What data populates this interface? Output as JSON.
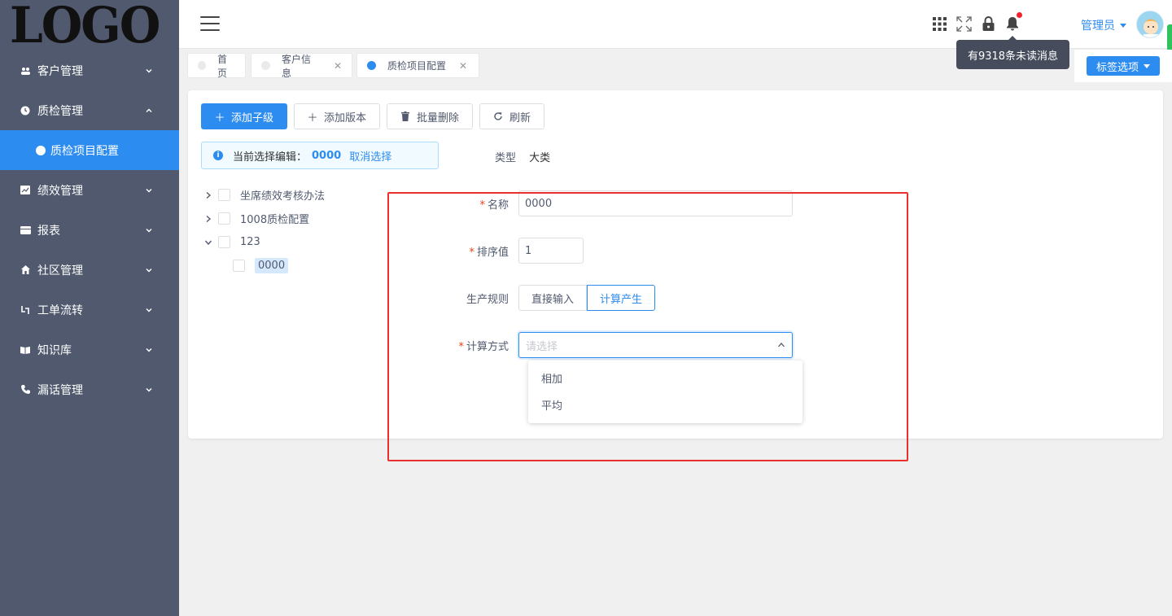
{
  "logo": "LOGO",
  "sidebar": {
    "items": [
      {
        "label": "客户管理",
        "icon": "users-icon",
        "expanded": false
      },
      {
        "label": "质检管理",
        "icon": "clock-icon",
        "expanded": true,
        "children": [
          {
            "label": "质检项目配置",
            "icon": "dot-icon"
          }
        ]
      },
      {
        "label": "绩效管理",
        "icon": "chart-icon",
        "expanded": false
      },
      {
        "label": "报表",
        "icon": "table-icon",
        "expanded": false
      },
      {
        "label": "社区管理",
        "icon": "home-icon",
        "expanded": false
      },
      {
        "label": "工单流转",
        "icon": "flow-icon",
        "expanded": false
      },
      {
        "label": "知识库",
        "icon": "book-icon",
        "expanded": false
      },
      {
        "label": "漏话管理",
        "icon": "phone-icon",
        "expanded": false
      }
    ],
    "colors": {
      "bg": "#50596e",
      "active": "#2d8cf0"
    }
  },
  "header": {
    "user_label": "管理员",
    "tooltip": "有9318条未读消息",
    "icons": [
      "apps-icon",
      "fullscreen-icon",
      "lock-icon",
      "bell-icon"
    ]
  },
  "tabs": {
    "items": [
      {
        "label": "首页",
        "active": false,
        "closable": false
      },
      {
        "label": "客户信息",
        "active": false,
        "closable": true
      },
      {
        "label": "质检项目配置",
        "active": true,
        "closable": true
      }
    ],
    "options_label": "标签选项"
  },
  "toolbar": {
    "add_child": "添加子级",
    "add_version": "添加版本",
    "batch_delete": "批量删除",
    "refresh": "刷新"
  },
  "alert": {
    "prefix": "当前选择编辑：",
    "value": "0000",
    "cancel": "取消选择"
  },
  "type": {
    "label": "类型",
    "value": "大类"
  },
  "tree": [
    {
      "label": "坐席绩效考核办法",
      "expanded": false
    },
    {
      "label": "1008质检配置",
      "expanded": false
    },
    {
      "label": "123",
      "expanded": true,
      "children": [
        {
          "label": "0000",
          "selected": true
        }
      ]
    }
  ],
  "form": {
    "name": {
      "label": "名称",
      "value": "0000",
      "required": true
    },
    "sort": {
      "label": "排序值",
      "value": "1",
      "required": true
    },
    "rule": {
      "label": "生产规则",
      "options": [
        "直接输入",
        "计算产生"
      ],
      "selected": "计算产生"
    },
    "calc": {
      "label": "计算方式",
      "placeholder": "请选择",
      "required": true,
      "options": [
        "相加",
        "平均"
      ]
    }
  }
}
